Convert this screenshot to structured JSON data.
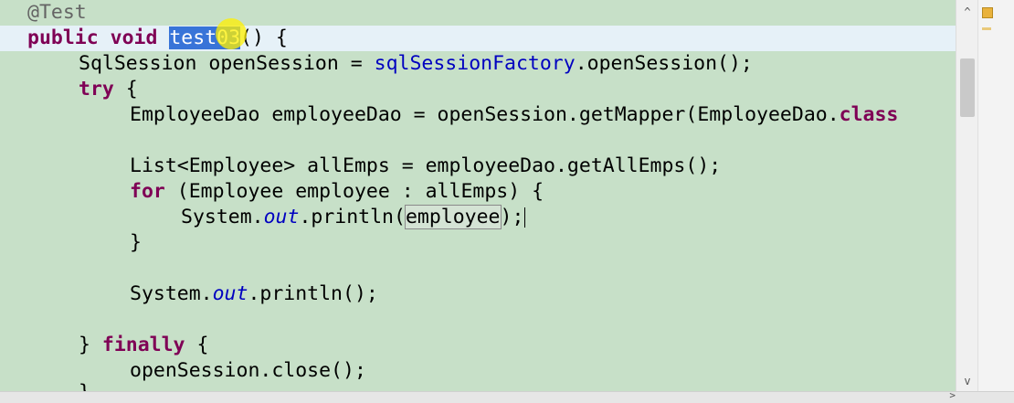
{
  "editor": {
    "lines": [
      {
        "annotation": "@Test"
      },
      {
        "kw1": "public",
        "kw2": "void",
        "method_selected": "test03",
        "rest": "() {"
      },
      {
        "type": "SqlSession",
        "var": "openSession",
        "eq": " = ",
        "field": "sqlSessionFactory",
        "call": ".openSession();"
      },
      {
        "kw": "try",
        "rest": " {"
      },
      {
        "text": "EmployeeDao employeeDao = openSession.getMapper(EmployeeDao.",
        "kw": "class"
      },
      {
        "text": ""
      },
      {
        "text": "List<Employee> allEmps = employeeDao.getAllEmps();"
      },
      {
        "kw": "for",
        "rest": " (Employee employee : allEmps) {"
      },
      {
        "pre": "System.",
        "field": "out",
        "mid": ".println(",
        "occurrence": "employee",
        "end": ");"
      },
      {
        "text": "}"
      },
      {
        "text": ""
      },
      {
        "pre": "System.",
        "field": "out",
        "end": ".println();"
      },
      {
        "text": ""
      },
      {
        "pre": "} ",
        "kw": "finally",
        "rest": " {"
      },
      {
        "text": "openSession.close();"
      },
      {
        "text": "}"
      }
    ]
  },
  "scrollbar": {
    "up_arrow": "^",
    "down_arrow": "v",
    "h_arrow": ">"
  },
  "colors": {
    "editor_bg": "#c7e0c8",
    "keyword": "#7f0055",
    "field": "#0000c0",
    "selection": "#3874d8",
    "current_line": "#e6f1f8"
  }
}
